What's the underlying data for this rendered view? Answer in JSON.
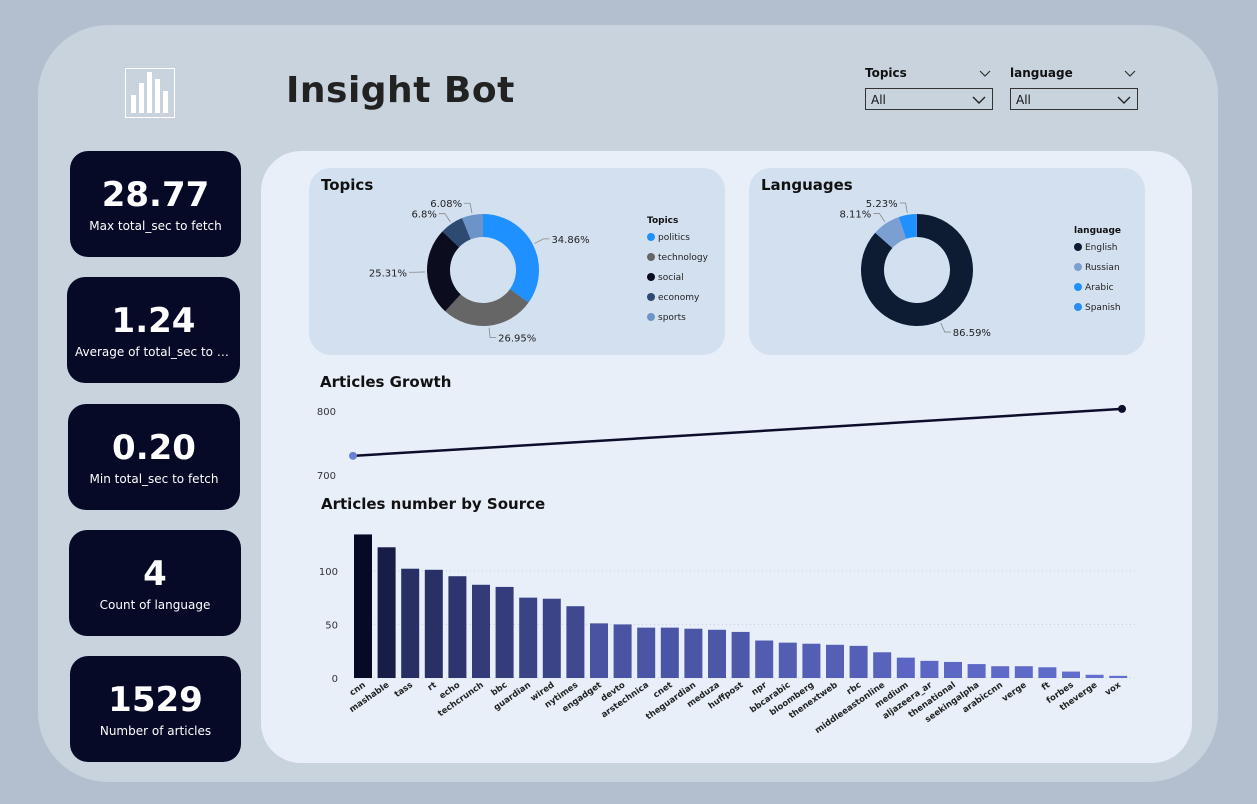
{
  "app": {
    "title": "Insight Bot"
  },
  "filters": [
    {
      "label": "Topics",
      "value": "All"
    },
    {
      "label": "language",
      "value": "All"
    }
  ],
  "kpis": [
    {
      "value": "28.77",
      "label": "Max total_sec to fetch"
    },
    {
      "value": "1.24",
      "label": "Average of total_sec to fetch"
    },
    {
      "value": "0.20",
      "label": "Min total_sec to fetch"
    },
    {
      "value": "4",
      "label": "Count of language"
    },
    {
      "value": "1529",
      "label": "Number of articles"
    }
  ],
  "colors": {
    "dark": "#060a26",
    "panel": "#e8eff9",
    "card": "#d3e0f0"
  },
  "chart_data": [
    {
      "type": "pie",
      "title": "Topics",
      "legend_title": "Topics",
      "legend_position": "right",
      "slices": [
        {
          "label": "politics",
          "value": 34.86,
          "text": "34.86%",
          "color": "#1e90ff"
        },
        {
          "label": "technology",
          "value": 26.95,
          "text": "26.95%",
          "color": "#666666"
        },
        {
          "label": "social",
          "value": 25.31,
          "text": "25.31%",
          "color": "#0b0d1e"
        },
        {
          "label": "economy",
          "value": 6.8,
          "text": "6.8%",
          "color": "#2e4a70"
        },
        {
          "label": "sports",
          "value": 6.08,
          "text": "6.08%",
          "color": "#6d94c8"
        }
      ]
    },
    {
      "type": "pie",
      "title": "Languages",
      "legend_title": "language",
      "legend_position": "right",
      "slices": [
        {
          "label": "English",
          "value": 86.59,
          "text": "86.59%",
          "color": "#0d1b33"
        },
        {
          "label": "Russian",
          "value": 8.11,
          "text": "8.11%",
          "color": "#7a9fd0"
        },
        {
          "label": "Arabic",
          "value": 5.23,
          "text": "5.23%",
          "color": "#1e90ff"
        },
        {
          "label": "Spanish",
          "value": 0.07,
          "text": "",
          "color": "#2a8cf0"
        }
      ]
    },
    {
      "type": "line",
      "title": "Articles Growth",
      "x": [
        1,
        2
      ],
      "y": [
        730,
        803
      ],
      "ylim": [
        680,
        820
      ],
      "yticks": [
        700,
        800
      ],
      "grid": false
    },
    {
      "type": "bar",
      "title": "Articles number by Source",
      "categories": [
        "cnn",
        "mashable",
        "tass",
        "rt",
        "echo",
        "techcrunch",
        "bbc",
        "guardian",
        "wired",
        "nytimes",
        "engadget",
        "devto",
        "arstechnica",
        "cnet",
        "theguardian",
        "meduza",
        "huffpost",
        "npr",
        "bbcarabic",
        "bloomberg",
        "thenextweb",
        "rbc",
        "middleeastonline",
        "medium",
        "aljazeera_ar",
        "thenational",
        "seekingalpha",
        "arabiccnn",
        "verge",
        "ft",
        "forbes",
        "theverge",
        "vox"
      ],
      "values": [
        134,
        122,
        102,
        101,
        95,
        87,
        85,
        75,
        74,
        67,
        51,
        50,
        47,
        47,
        46,
        45,
        43,
        35,
        33,
        32,
        31,
        30,
        24,
        19,
        16,
        15,
        13,
        11,
        11,
        10,
        6,
        3,
        2
      ],
      "ylim": [
        0,
        140
      ],
      "yticks": [
        0,
        50,
        100
      ],
      "grid": true
    }
  ]
}
